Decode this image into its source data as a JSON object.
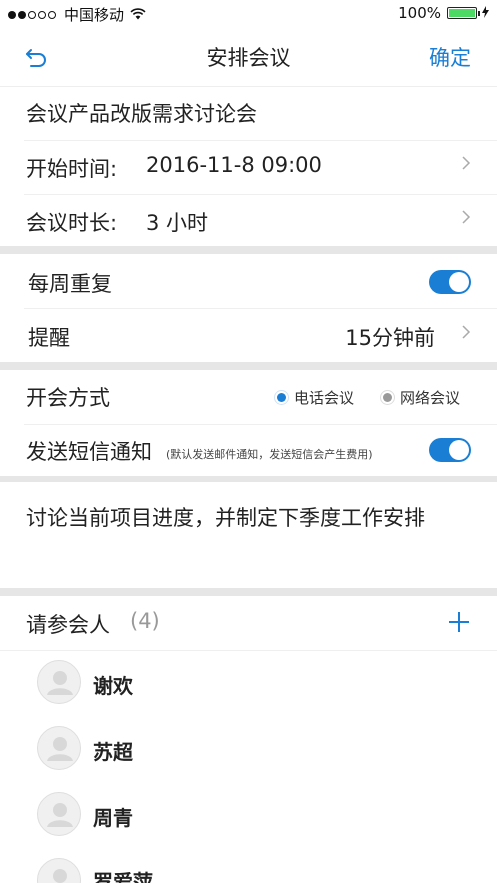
{
  "status_bar": {
    "carrier": "中国移动",
    "battery_percent": "100%",
    "battery_level": 1.0,
    "signal_strength_dots": 2,
    "icons": [
      "signal-dots-icon",
      "wifi-icon",
      "battery-icon",
      "charging-icon"
    ]
  },
  "nav": {
    "title": "安排会议",
    "confirm": "确定",
    "back_icon": "back-arrow-icon"
  },
  "meeting": {
    "subject": "会议产品改版需求讨论会",
    "start_label": "开始时间:",
    "start_value": "2016-11-8   09:00",
    "duration_label": "会议时长:",
    "duration_value": "3 小时"
  },
  "repeat": {
    "label": "每周重复",
    "enabled": true
  },
  "reminder": {
    "label": "提醒",
    "value": "15分钟前"
  },
  "meeting_type": {
    "label": "开会方式",
    "options": [
      "电话会议",
      "网络会议"
    ],
    "selected": "电话会议"
  },
  "sms": {
    "label": "发送短信通知",
    "note": "(默认发送邮件通知，发送短信会产生费用)",
    "enabled": true
  },
  "description": "讨论当前项目进度，并制定下季度工作安排",
  "attendees": {
    "label": "请参会人",
    "count": "(4)",
    "add_icon": "plus-icon",
    "list": [
      {
        "name": "谢欢"
      },
      {
        "name": "苏超"
      },
      {
        "name": "周青"
      },
      {
        "name": "罗爱萍"
      }
    ]
  },
  "colors": {
    "accent": "#1a7fd4",
    "toggle_on": "#1a7fd4",
    "section_gap": "#e6e6e6"
  }
}
